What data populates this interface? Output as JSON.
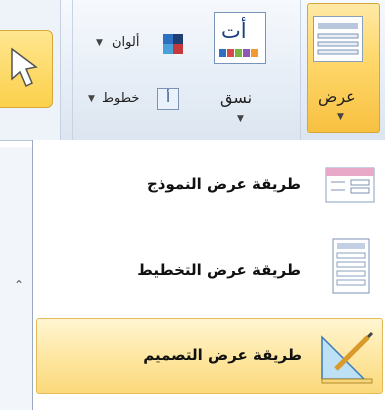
{
  "ribbon": {
    "view_button": {
      "label": "عرض"
    },
    "format_button": {
      "label": "نسق"
    },
    "colors": {
      "label": "ألوان"
    },
    "fonts": {
      "label": "خطوط"
    },
    "format_icon_glyph": "أت",
    "fonts_icon_glyph": "أ"
  },
  "view_menu": {
    "items": [
      {
        "label": "طريقة عرض النموذج",
        "icon": "form-view-icon",
        "selected": false
      },
      {
        "label": "طريقة عرض التخطيط",
        "icon": "layout-view-icon",
        "selected": false
      },
      {
        "label": "طريقة عرض التصميم",
        "icon": "design-view-icon",
        "selected": true
      }
    ]
  },
  "colors": {
    "accent_yellow": "#fbd04b",
    "ribbon_blue": "#e6edf6",
    "selection_border": "#e4b957"
  }
}
